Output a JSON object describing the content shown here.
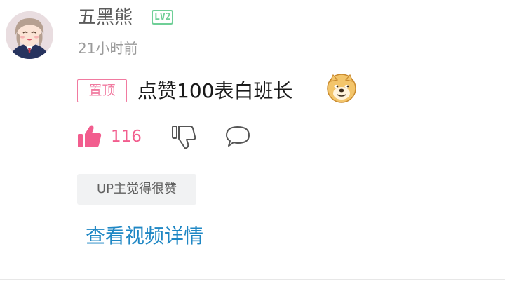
{
  "comment": {
    "username": "五黑熊",
    "level_badge": "LV2",
    "timestamp": "21小时前",
    "pin_badge": "置顶",
    "content": "点赞100表白班长",
    "emoji_icon": "doge-icon",
    "like_count": "116",
    "up_tag": "UP主觉得很赞",
    "view_detail_link": "查看视频详情"
  },
  "colors": {
    "pink": "#f25d8e",
    "level_green": "#6fcf97",
    "link_blue": "#1f87c4",
    "muted_text": "#9a9a9a"
  }
}
